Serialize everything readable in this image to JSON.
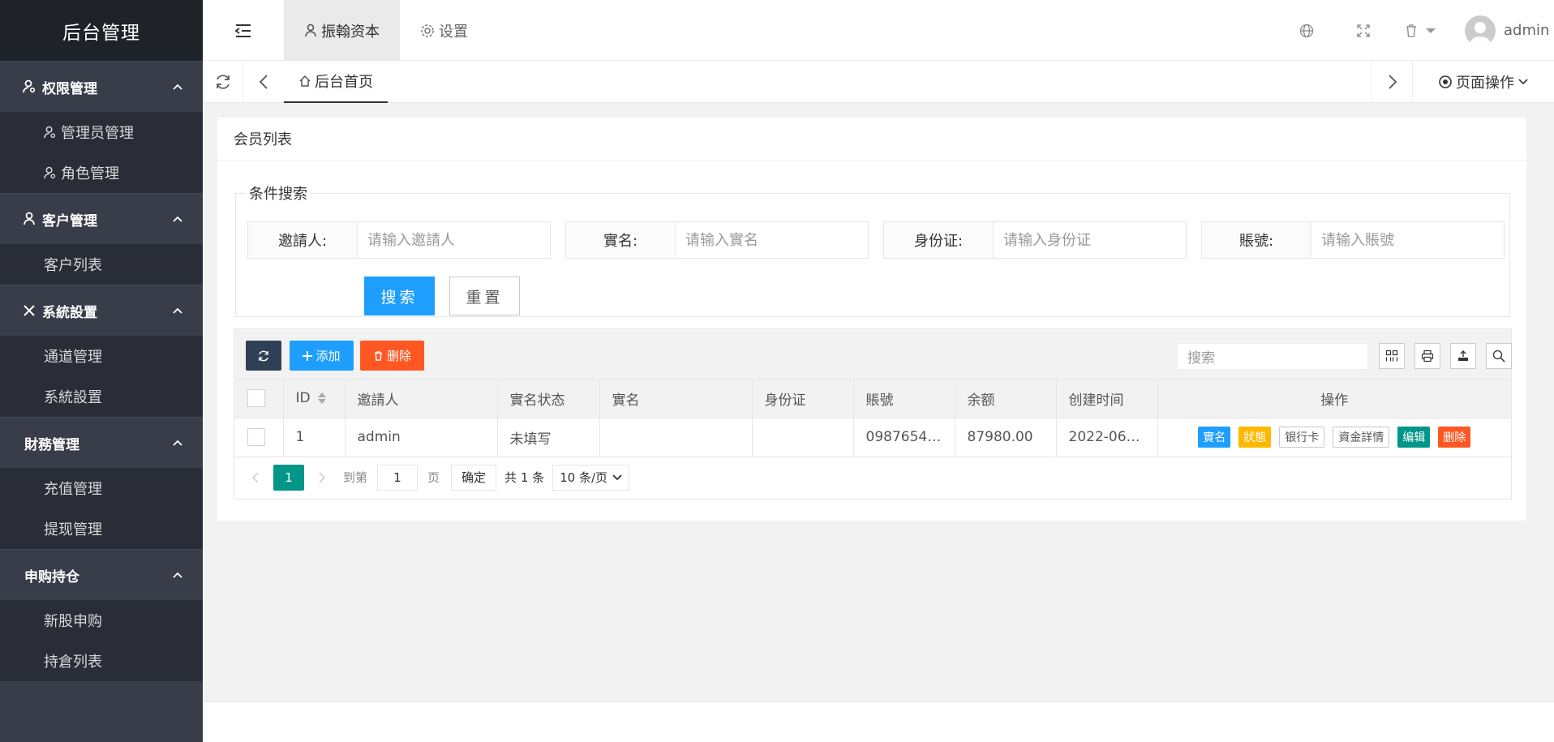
{
  "sidebar": {
    "logo": "后台管理",
    "groups": [
      {
        "title": "权限管理",
        "icon": "user-gear-icon",
        "items": [
          "管理员管理",
          "角色管理"
        ]
      },
      {
        "title": "客户管理",
        "icon": "user-icon",
        "items": [
          "客户列表"
        ]
      },
      {
        "title": "系統設置",
        "icon": "tools-icon",
        "items": [
          "通道管理",
          "系統設置"
        ]
      },
      {
        "title": "財務管理",
        "items": [
          "充值管理",
          "提现管理"
        ]
      },
      {
        "title": "申购持仓",
        "items": [
          "新股申购",
          "持倉列表"
        ]
      }
    ]
  },
  "header": {
    "nav": [
      {
        "label": "振翰资本",
        "icon": "user-icon"
      },
      {
        "label": "设置",
        "icon": "gear-icon"
      }
    ],
    "user": "admin"
  },
  "tabs": {
    "home": "后台首页",
    "page_ops": "页面操作"
  },
  "card": {
    "title": "会员列表",
    "legend": "条件搜索",
    "fields": [
      {
        "label": "邀請人:",
        "placeholder": "请输入邀請人"
      },
      {
        "label": "實名:",
        "placeholder": "请输入實名"
      },
      {
        "label": "身份证:",
        "placeholder": "请输入身份证"
      },
      {
        "label": "賬號:",
        "placeholder": "请输入賬號"
      }
    ],
    "search_btn": "搜索",
    "reset_btn": "重置"
  },
  "toolbar": {
    "add": "添加",
    "delete": "删除",
    "search_placeholder": "搜索"
  },
  "table": {
    "headers": [
      "ID",
      "邀請人",
      "實名状态",
      "實名",
      "身份证",
      "賬號",
      "余额",
      "创建时间",
      "操作"
    ],
    "rows": [
      {
        "id": "1",
        "inviter": "admin",
        "status": "未填写",
        "name": "",
        "idcard": "",
        "account": "0987654…",
        "balance": "87980.00",
        "created": "2022-06…"
      }
    ],
    "ops": [
      "實名",
      "狀態",
      "银行卡",
      "資金詳情",
      "编辑",
      "删除"
    ]
  },
  "pager": {
    "current": "1",
    "goto": "到第",
    "page_input": "1",
    "page_unit": "页",
    "confirm": "确定",
    "total": "共 1 条",
    "size": "10 条/页"
  }
}
